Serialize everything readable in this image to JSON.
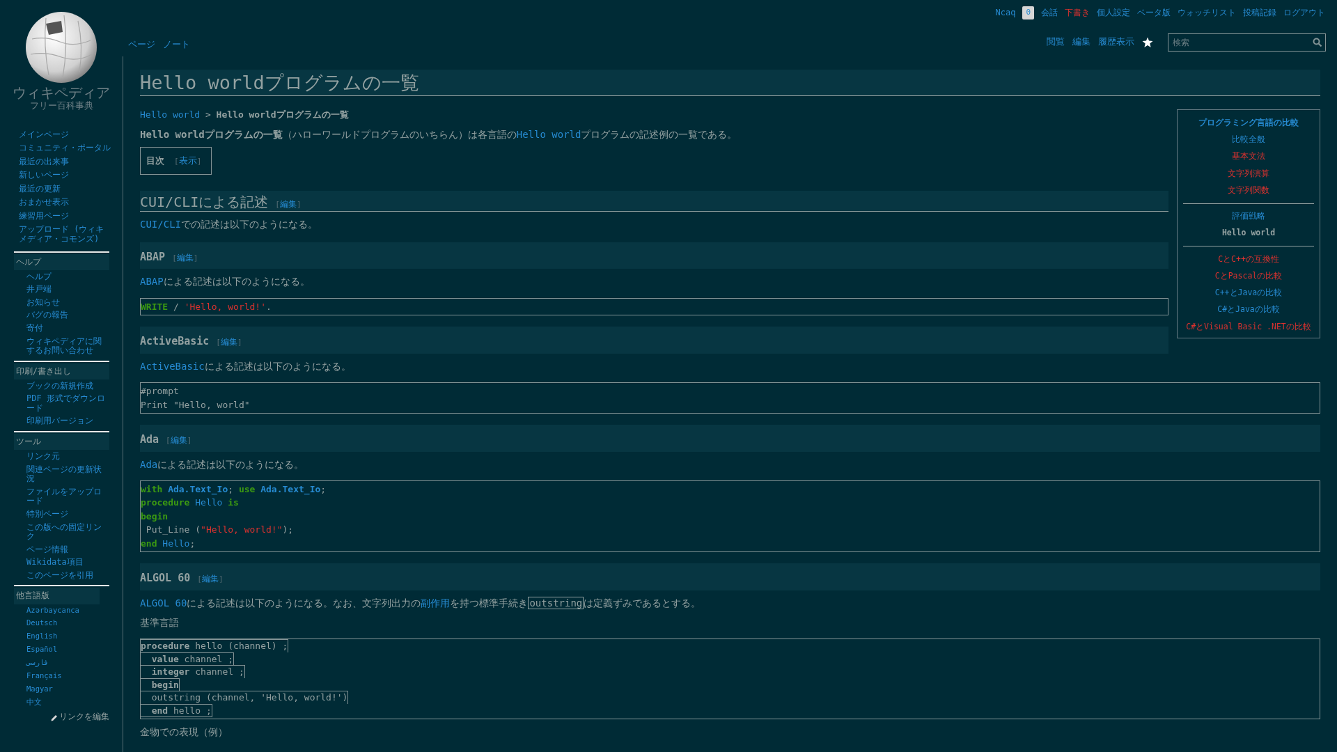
{
  "logo": {
    "title": "ウィキペディア",
    "tagline": "フリー百科事典"
  },
  "personal_tools": [
    {
      "label": "Ncaq",
      "kind": "link"
    },
    {
      "label": "0",
      "kind": "badge"
    },
    {
      "label": "会話",
      "kind": "link"
    },
    {
      "label": "下書き",
      "kind": "redlink"
    },
    {
      "label": "個人設定",
      "kind": "link"
    },
    {
      "label": "ベータ版",
      "kind": "link"
    },
    {
      "label": "ウォッチリスト",
      "kind": "link"
    },
    {
      "label": "投稿記録",
      "kind": "link"
    },
    {
      "label": "ログアウト",
      "kind": "link"
    }
  ],
  "namespace_tabs": [
    "ページ",
    "ノート"
  ],
  "view_tabs": [
    "閲覧",
    "編集",
    "履歴表示"
  ],
  "search": {
    "placeholder": "検索"
  },
  "sidebar": {
    "navigation": [
      "メインページ",
      "コミュニティ・ポータル",
      "最近の出来事",
      "新しいページ",
      "最近の更新",
      "おまかせ表示",
      "練習用ページ",
      "アップロード (ウィキメディア・コモンズ)"
    ],
    "portals": [
      {
        "title": "ヘルプ",
        "kind": "menu",
        "items": [
          "ヘルプ",
          "井戸端",
          "お知らせ",
          "バグの報告",
          "寄付",
          "ウィキペディアに関するお問い合わせ"
        ]
      },
      {
        "title": "印刷/書き出し",
        "kind": "menu",
        "items": [
          "ブックの新規作成",
          "PDF 形式でダウンロード",
          "印刷用バージョン"
        ]
      },
      {
        "title": "ツール",
        "kind": "menu",
        "items": [
          "リンク元",
          "関連ページの更新状況",
          "ファイルをアップロード",
          "特別ページ",
          "この版への固定リンク",
          "ページ情報",
          "Wikidata項目",
          "このページを引用"
        ]
      },
      {
        "title": "他言語版",
        "kind": "languages",
        "items": [
          "Azərbaycanca",
          "Deutsch",
          "English",
          "Español",
          "فارسی",
          "Français",
          "Magyar",
          "中文"
        ]
      }
    ],
    "edit_links": "リンクを編集"
  },
  "article": {
    "title": "Hello worldプログラムの一覧",
    "breadcrumb": [
      {
        "text": "Hello world",
        "kind": "link"
      },
      {
        "text": " > ",
        "kind": "text"
      },
      {
        "text": "Hello worldプログラムの一覧",
        "kind": "bold"
      }
    ],
    "intro": [
      {
        "text": "Hello worldプログラムの一覧",
        "kind": "bold"
      },
      {
        "text": "（ハローワールドプログラムのいちらん）は各言語の",
        "kind": "text"
      },
      {
        "text": "Hello world",
        "kind": "link"
      },
      {
        "text": "プログラムの記述例の一覧である。",
        "kind": "text"
      }
    ],
    "toc": {
      "title": "目次",
      "open": "[",
      "toggle": "表示",
      "close": "]"
    },
    "blocks": [
      {
        "kind": "h2",
        "text": "CUI/CLIによる記述",
        "edit": {
          "open": "[",
          "label": "編集",
          "close": "]"
        }
      },
      {
        "kind": "para",
        "segments": [
          {
            "text": "CUI/CLI",
            "kind": "link"
          },
          {
            "text": "での記述は以下のようになる。",
            "kind": "text"
          }
        ]
      },
      {
        "kind": "h3",
        "text": "ABAP",
        "edit": {
          "open": "[",
          "label": "編集",
          "close": "]"
        }
      },
      {
        "kind": "para",
        "segments": [
          {
            "text": "ABAP",
            "kind": "link"
          },
          {
            "text": "による記述は以下のようになる。",
            "kind": "text"
          }
        ]
      },
      {
        "kind": "code",
        "lines": [
          [
            {
              "text": "WRITE",
              "kind": "keyword"
            },
            {
              "text": " / ",
              "kind": "plain"
            },
            {
              "text": "'Hello, world!'",
              "kind": "string"
            },
            {
              "text": ".",
              "kind": "plain"
            }
          ]
        ]
      },
      {
        "kind": "h3",
        "text": "ActiveBasic",
        "edit": {
          "open": "[",
          "label": "編集",
          "close": "]"
        }
      },
      {
        "kind": "para",
        "segments": [
          {
            "text": "ActiveBasic",
            "kind": "link"
          },
          {
            "text": "による記述は以下のようになる。",
            "kind": "text"
          }
        ]
      },
      {
        "kind": "code",
        "lines": [
          [
            {
              "text": "#prompt",
              "kind": "plain"
            }
          ],
          [
            {
              "text": "Print \"Hello, world\"",
              "kind": "plain"
            }
          ]
        ]
      },
      {
        "kind": "h3",
        "text": "Ada",
        "edit": {
          "open": "[",
          "label": "編集",
          "close": "]"
        }
      },
      {
        "kind": "para",
        "segments": [
          {
            "text": "Ada",
            "kind": "link"
          },
          {
            "text": "による記述は以下のようになる。",
            "kind": "text"
          }
        ]
      },
      {
        "kind": "code",
        "lines": [
          [
            {
              "text": "with ",
              "kind": "keyword"
            },
            {
              "text": "Ada.Text_Io",
              "kind": "name"
            },
            {
              "text": "; ",
              "kind": "plain"
            },
            {
              "text": "use ",
              "kind": "keyword"
            },
            {
              "text": "Ada.Text_Io",
              "kind": "name"
            },
            {
              "text": ";",
              "kind": "plain"
            }
          ],
          [
            {
              "text": "procedure ",
              "kind": "keyword"
            },
            {
              "text": "Hello ",
              "kind": "ident"
            },
            {
              "text": "is",
              "kind": "keyword"
            }
          ],
          [
            {
              "text": "begin",
              "kind": "keyword"
            }
          ],
          [
            {
              "text": " Put_Line (",
              "kind": "plain"
            },
            {
              "text": "\"Hello, world!\"",
              "kind": "string"
            },
            {
              "text": ");",
              "kind": "plain"
            }
          ],
          [
            {
              "text": "end ",
              "kind": "keyword"
            },
            {
              "text": "Hello",
              "kind": "ident"
            },
            {
              "text": ";",
              "kind": "plain"
            }
          ]
        ]
      },
      {
        "kind": "h3",
        "text": "ALGOL 60",
        "edit": {
          "open": "[",
          "label": "編集",
          "close": "]"
        }
      },
      {
        "kind": "para",
        "segments": [
          {
            "text": "ALGOL 60",
            "kind": "link"
          },
          {
            "text": "による記述は以下のようになる。なお、文字列出力の",
            "kind": "text"
          },
          {
            "text": "副作用",
            "kind": "link"
          },
          {
            "text": "を持つ標準手続き",
            "kind": "text"
          },
          {
            "text": "outstring",
            "kind": "code"
          },
          {
            "text": "は定義ずみであるとする。",
            "kind": "text"
          }
        ]
      },
      {
        "kind": "para",
        "segments": [
          {
            "text": "基準言語",
            "kind": "text"
          }
        ]
      },
      {
        "kind": "boxed_code",
        "lines": [
          [
            {
              "text": "procedure",
              "kind": "bold"
            },
            {
              "text": " hello (channel) ;",
              "kind": "plain"
            }
          ],
          [
            {
              "text": "  value",
              "kind": "bold"
            },
            {
              "text": " channel ;",
              "kind": "plain"
            }
          ],
          [
            {
              "text": "  integer",
              "kind": "bold"
            },
            {
              "text": " channel ;",
              "kind": "plain"
            }
          ],
          [
            {
              "text": "  begin",
              "kind": "bold"
            }
          ],
          [
            {
              "text": "  outstring (channel, 'Hello, world!')",
              "kind": "plain"
            }
          ],
          [
            {
              "text": "  end",
              "kind": "bold"
            },
            {
              "text": " hello ;",
              "kind": "plain"
            }
          ]
        ]
      },
      {
        "kind": "para",
        "segments": [
          {
            "text": "金物での表現（例）",
            "kind": "text"
          }
        ]
      }
    ]
  },
  "navbox": {
    "title": "プログラミング言語の比較",
    "groups": [
      [
        {
          "label": "比較全般",
          "kind": "link"
        },
        {
          "label": "基本文法",
          "kind": "redlink"
        },
        {
          "label": "文字列演算",
          "kind": "redlink"
        },
        {
          "label": "文字列関数",
          "kind": "redlink"
        }
      ],
      [
        {
          "label": "評価戦略",
          "kind": "link"
        },
        {
          "label": "Hello world",
          "kind": "current"
        }
      ],
      [
        {
          "label": "CとC++の互換性",
          "kind": "redlink"
        },
        {
          "label": "CとPascalの比較",
          "kind": "redlink"
        },
        {
          "label": "C++とJavaの比較",
          "kind": "link"
        },
        {
          "label": "C#とJavaの比較",
          "kind": "link"
        },
        {
          "label": "C#とVisual Basic .NETの比較",
          "kind": "redlink"
        }
      ]
    ]
  }
}
